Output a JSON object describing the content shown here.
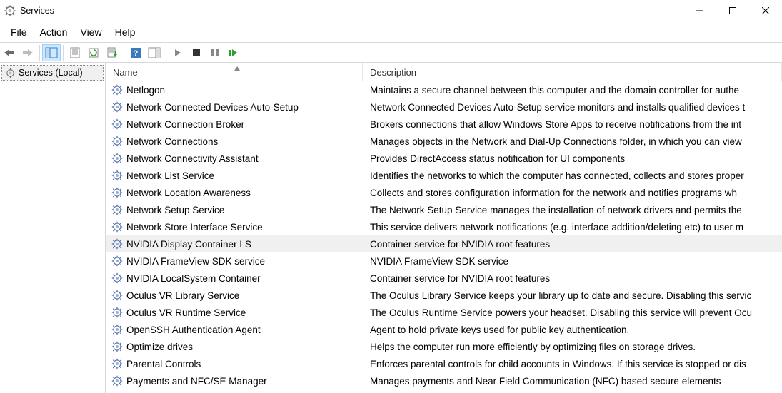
{
  "titlebar": {
    "title": "Services"
  },
  "menubar": {
    "items": [
      "File",
      "Action",
      "View",
      "Help"
    ]
  },
  "tree": {
    "root": "Services (Local)"
  },
  "columns": {
    "name": "Name",
    "description": "Description"
  },
  "selected_index": 9,
  "services": [
    {
      "name": "Netlogon",
      "description": "Maintains a secure channel between this computer and the domain controller for authe"
    },
    {
      "name": "Network Connected Devices Auto-Setup",
      "description": "Network Connected Devices Auto-Setup service monitors and installs qualified devices t"
    },
    {
      "name": "Network Connection Broker",
      "description": "Brokers connections that allow Windows Store Apps to receive notifications from the int"
    },
    {
      "name": "Network Connections",
      "description": "Manages objects in the Network and Dial-Up Connections folder, in which you can view"
    },
    {
      "name": "Network Connectivity Assistant",
      "description": "Provides DirectAccess status notification for UI components"
    },
    {
      "name": "Network List Service",
      "description": "Identifies the networks to which the computer has connected, collects and stores proper"
    },
    {
      "name": "Network Location Awareness",
      "description": "Collects and stores configuration information for the network and notifies programs wh"
    },
    {
      "name": "Network Setup Service",
      "description": "The Network Setup Service manages the installation of network drivers and permits the"
    },
    {
      "name": "Network Store Interface Service",
      "description": "This service delivers network notifications (e.g. interface addition/deleting etc) to user m"
    },
    {
      "name": "NVIDIA Display Container LS",
      "description": "Container service for NVIDIA root features"
    },
    {
      "name": "NVIDIA FrameView SDK service",
      "description": "NVIDIA FrameView SDK service"
    },
    {
      "name": "NVIDIA LocalSystem Container",
      "description": "Container service for NVIDIA root features"
    },
    {
      "name": "Oculus VR Library Service",
      "description": "The Oculus Library Service keeps your library up to date and secure. Disabling this servic"
    },
    {
      "name": "Oculus VR Runtime Service",
      "description": "The Oculus Runtime Service powers your headset. Disabling this service will prevent Ocu"
    },
    {
      "name": "OpenSSH Authentication Agent",
      "description": "Agent to hold private keys used for public key authentication."
    },
    {
      "name": "Optimize drives",
      "description": "Helps the computer run more efficiently by optimizing files on storage drives."
    },
    {
      "name": "Parental Controls",
      "description": "Enforces parental controls for child accounts in Windows. If this service is stopped or dis"
    },
    {
      "name": "Payments and NFC/SE Manager",
      "description": "Manages payments and Near Field Communication (NFC) based secure elements"
    }
  ]
}
